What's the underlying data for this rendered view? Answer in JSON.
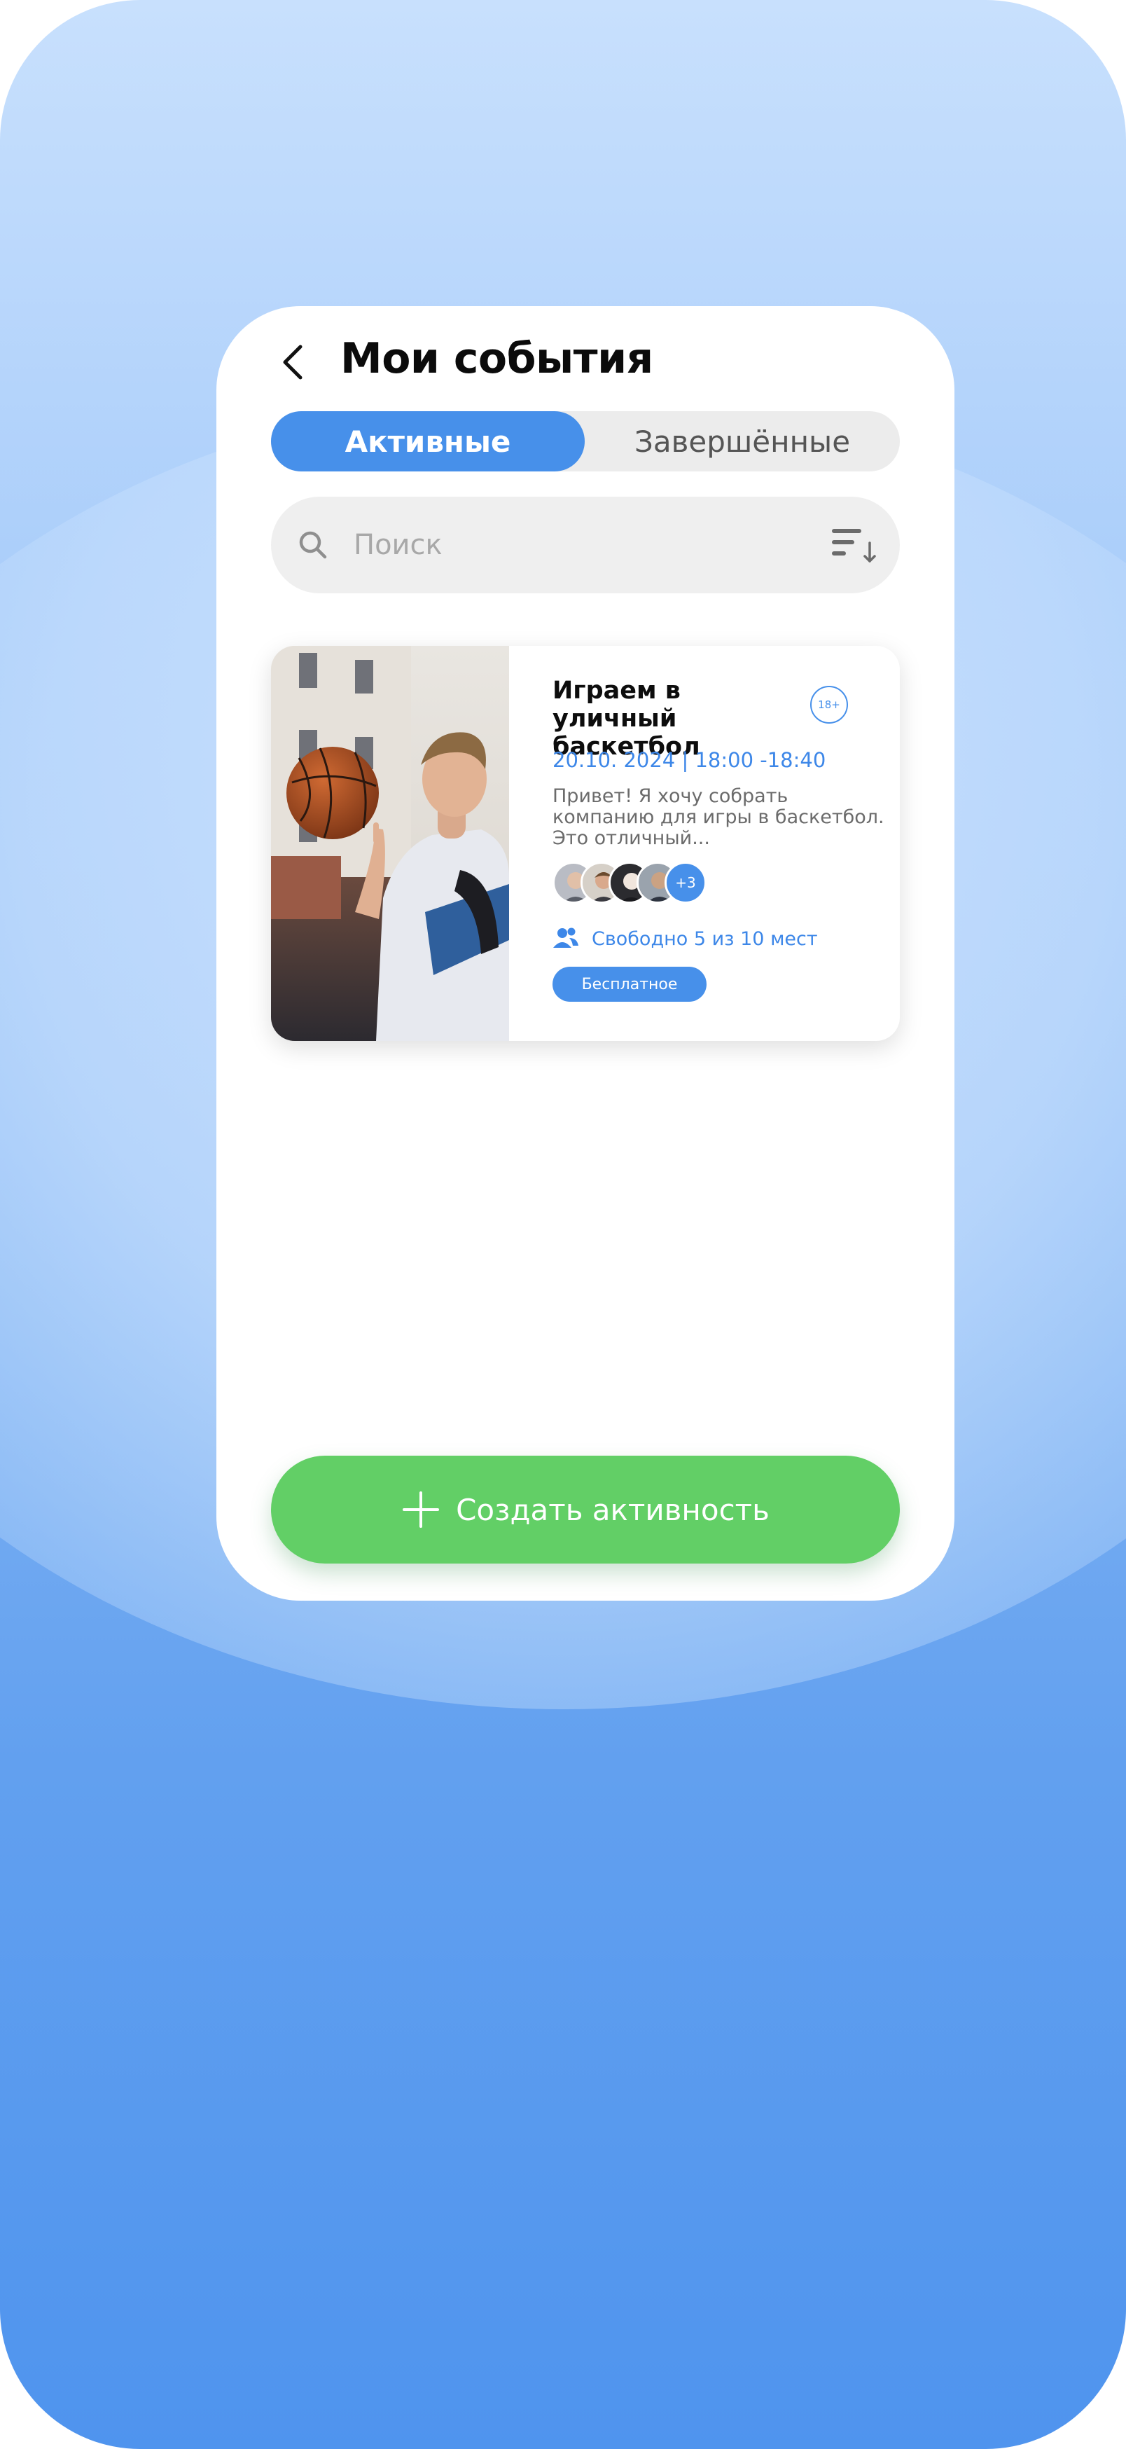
{
  "header": {
    "title": "Мои события"
  },
  "tabs": [
    {
      "label": "Активные",
      "active": true
    },
    {
      "label": "Завершённые",
      "active": false
    }
  ],
  "search": {
    "placeholder": "Поиск"
  },
  "events": [
    {
      "title": "Играем в уличный баскетбол",
      "age_badge": "18+",
      "datetime": "20.10. 2024  |  18:00 -18:40",
      "description": "Привет! Я хочу собрать компанию для игры в баскетбол. Это отличный...",
      "participants_more": "+3",
      "seats": "Свободно 5 из 10 мест",
      "price_tag": "Бесплатное"
    }
  ],
  "actions": {
    "create_label": "Создать активность"
  },
  "colors": {
    "accent": "#4790ea",
    "create_button": "#62cf66",
    "background_top": "#c8e0fd",
    "background_bottom": "#4f94ee"
  },
  "icons": {
    "back": "chevron-left-icon",
    "search": "search-icon",
    "sort": "sort-icon",
    "people": "people-icon",
    "plus": "plus-icon"
  }
}
